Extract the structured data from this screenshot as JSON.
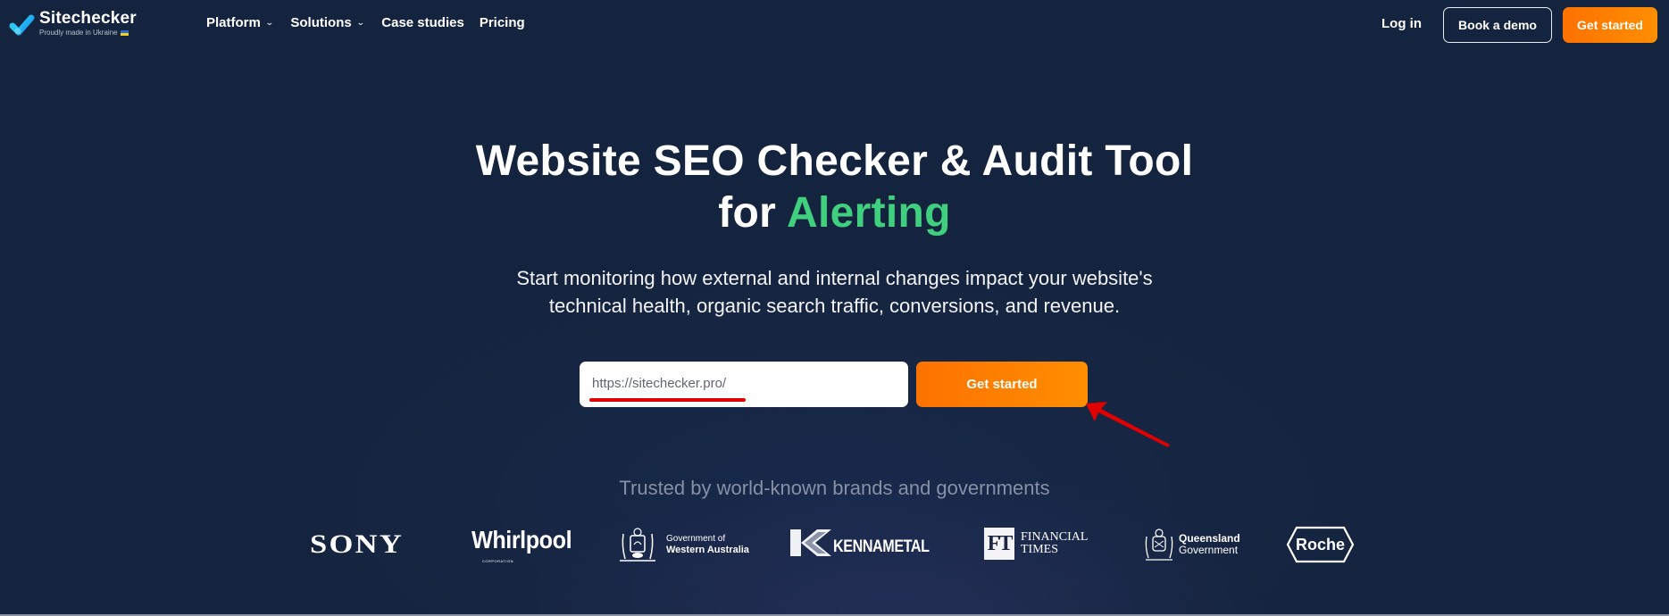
{
  "header": {
    "brand_name": "Sitechecker",
    "brand_tagline": "Proudly made in Ukraine",
    "nav": [
      {
        "label": "Platform",
        "has_dropdown": true
      },
      {
        "label": "Solutions",
        "has_dropdown": true
      },
      {
        "label": "Case studies",
        "has_dropdown": false
      },
      {
        "label": "Pricing",
        "has_dropdown": false
      }
    ],
    "login_label": "Log in",
    "book_demo_label": "Book a demo",
    "get_started_label": "Get started",
    "dropdown_icon": "chevron-down-icon"
  },
  "hero": {
    "title_line1": "Website SEO Checker & Audit Tool",
    "title_line2_prefix": "for ",
    "title_line2_accent": "Alerting",
    "subtitle_line1": "Start monitoring how external and internal changes impact your website's",
    "subtitle_line2": "technical health, organic search traffic, conversions, and revenue.",
    "url_input_value": "https://sitechecker.pro/",
    "cta_label": "Get started"
  },
  "trusted": {
    "heading": "Trusted by world-known brands and governments",
    "brands": [
      {
        "name": "SONY"
      },
      {
        "name": "Whirlpool",
        "sub": "CORPORATION"
      },
      {
        "name": "Government of Western Australia",
        "line1": "Government of",
        "line2": "Western Australia"
      },
      {
        "name": "KENNAMETAL"
      },
      {
        "name": "Financial Times",
        "mark": "FT",
        "line1": "FINANCIAL",
        "line2": "TIMES"
      },
      {
        "name": "Queensland Government",
        "line1": "Queensland",
        "line2": "Government"
      },
      {
        "name": "Roche"
      }
    ]
  },
  "colors": {
    "background": "#15243e",
    "accent_green": "#3fcf7f",
    "cta_orange_start": "#fd7200",
    "cta_orange_end": "#ff8e00",
    "annotation_red": "#e30000",
    "muted_text": "#8790a4"
  }
}
